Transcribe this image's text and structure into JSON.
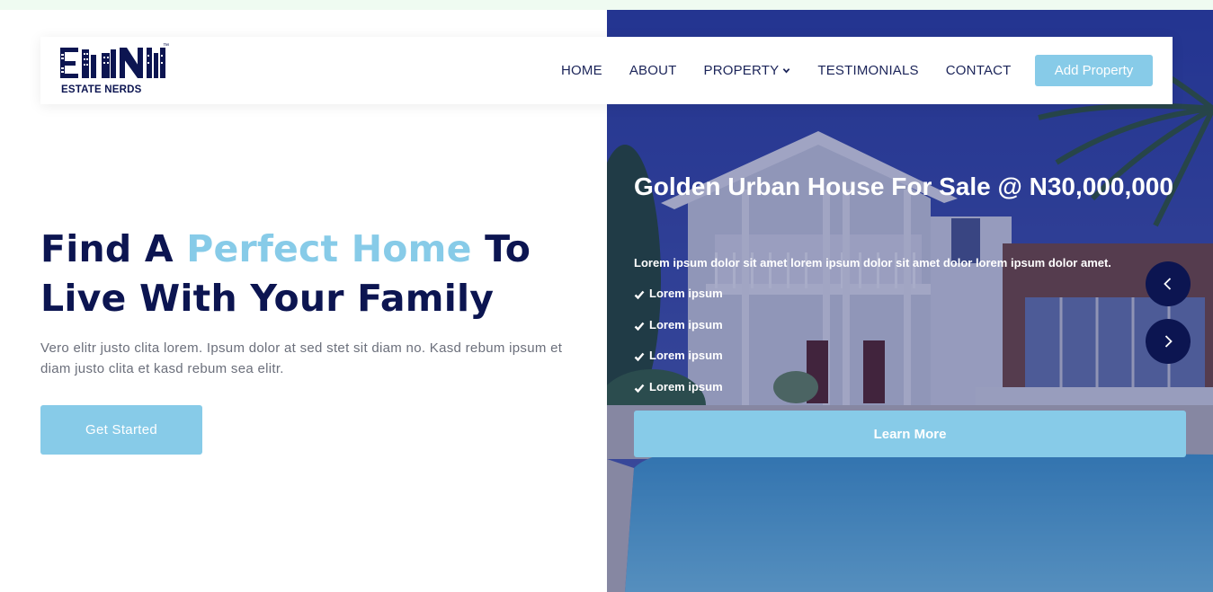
{
  "brand": {
    "name": "ESTATE NERDS",
    "trademark": "™"
  },
  "nav": {
    "items": [
      {
        "label": "HOME"
      },
      {
        "label": "ABOUT"
      },
      {
        "label": "PROPERTY"
      },
      {
        "label": "TESTIMONIALS"
      },
      {
        "label": "CONTACT"
      }
    ],
    "cta_label": "Add Property"
  },
  "hero": {
    "headline_part1": "Find A ",
    "headline_accent": "Perfect Home",
    "headline_part2": " To Live With Your Family",
    "lede": "Vero elitr justo clita lorem. Ipsum dolor at sed stet sit diam no. Kasd rebum ipsum et diam justo clita et kasd rebum sea elitr.",
    "cta_label": "Get Started"
  },
  "slide": {
    "title": "Golden Urban House For Sale @ N30,000,000",
    "description": "Lorem ipsum dolor sit amet lorem ipsum dolor sit amet dolor lorem ipsum dolor amet.",
    "features": [
      "Lorem ipsum",
      "Lorem ipsum",
      "Lorem ipsum",
      "Lorem ipsum"
    ],
    "cta_label": "Learn More"
  },
  "colors": {
    "navy": "#0c1551",
    "accent": "#87cbe8",
    "body_text": "#6b6f7b"
  },
  "icons": {
    "dropdown": "chevron-down-icon",
    "feature": "check-icon",
    "prev": "chevron-left-icon",
    "next": "chevron-right-icon"
  }
}
